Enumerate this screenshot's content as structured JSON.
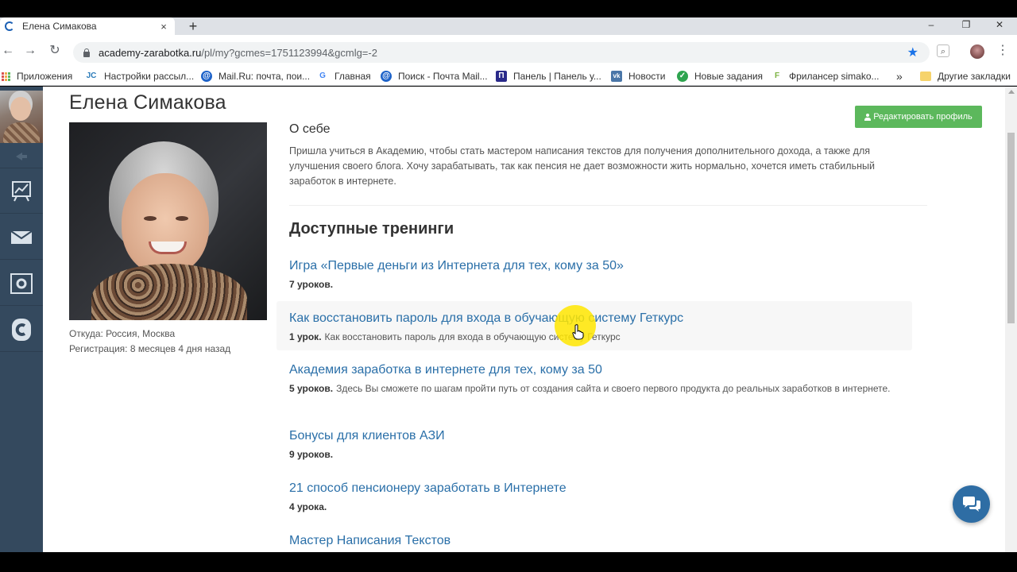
{
  "browser": {
    "tab_title": "Елена Симакова",
    "tab_close": "×",
    "new_tab": "+",
    "url_host": "academy-zarabotka.ru",
    "url_path": "/pl/my?gcmes=1751123994&gcmlg=-2",
    "window_controls": [
      "–",
      "❐",
      "✕"
    ]
  },
  "bookmarks": {
    "items": [
      {
        "label": "Приложения",
        "icon": "apps-icon"
      },
      {
        "label": "Настройки рассыл...",
        "icon": "jc-icon",
        "glyph": "JC",
        "color": "#2b7bb9"
      },
      {
        "label": "Mail.Ru: почта, пои...",
        "icon": "mailru-icon",
        "glyph": "@",
        "color": "#1e63c9"
      },
      {
        "label": "Главная",
        "icon": "google-icon",
        "glyph": "G",
        "color": "#4285f4"
      },
      {
        "label": "Поиск - Почта Mail...",
        "icon": "mailru-icon",
        "glyph": "@",
        "color": "#1e63c9"
      },
      {
        "label": "Панель | Панель у...",
        "icon": "panel-icon",
        "glyph": "П",
        "color": "#2a2a8a"
      },
      {
        "label": "Новости",
        "icon": "vk-icon",
        "glyph": "vk",
        "color": "#4a76a8"
      },
      {
        "label": "Новые задания",
        "icon": "check-icon",
        "glyph": "✓",
        "color": "#2ea44f"
      },
      {
        "label": "Фрилансер simako...",
        "icon": "freelancer-icon",
        "glyph": "F",
        "color": "#7cb342"
      }
    ],
    "overflow": "»",
    "other": "Другие закладки"
  },
  "profile": {
    "name": "Елена Симакова",
    "from": "Откуда: Россия, Москва",
    "registered": "Регистрация: 8 месяцев 4 дня назад",
    "edit_button": "Редактировать профиль"
  },
  "about": {
    "title": "О себе",
    "text": "Пришла учиться в Академию, чтобы стать мастером написания текстов для получения дополнительного дохода, а также для улучшения своего блога. Хочу зарабатывать, так как пенсия не дает возможности жить нормально, хочется иметь стабильный заработок в интернете."
  },
  "trainings": {
    "title": "Доступные тренинги",
    "items": [
      {
        "title": "Игра «Первые деньги из Интернета для тех, кому за 50»",
        "count": "7 уроков.",
        "description": ""
      },
      {
        "title": "Как восстановить пароль для входа в обучающую систему Геткурс",
        "count": "1 урок.",
        "description": "Как восстановить пароль для входа в обучающую систему Геткурс"
      },
      {
        "title": "Академия заработка в интернете для тех, кому за 50",
        "count": "5 уроков.",
        "description": "Здесь Вы сможете по шагам пройти путь от создания сайта и своего первого продукта до реальных заработков в интернете."
      },
      {
        "title": "Бонусы для клиентов АЗИ",
        "count": "9 уроков.",
        "description": ""
      },
      {
        "title": "21 способ пенсионеру заработать в Интернете",
        "count": "4 урока.",
        "description": ""
      },
      {
        "title": "Мастер Написания Текстов",
        "count": "",
        "description": ""
      }
    ]
  },
  "colors": {
    "link": "#2a6fa8",
    "edit_button": "#5cb85c",
    "side_rail": "#34495e",
    "chat_button": "#2e6da4",
    "cursor_highlight": "#ffe600"
  }
}
